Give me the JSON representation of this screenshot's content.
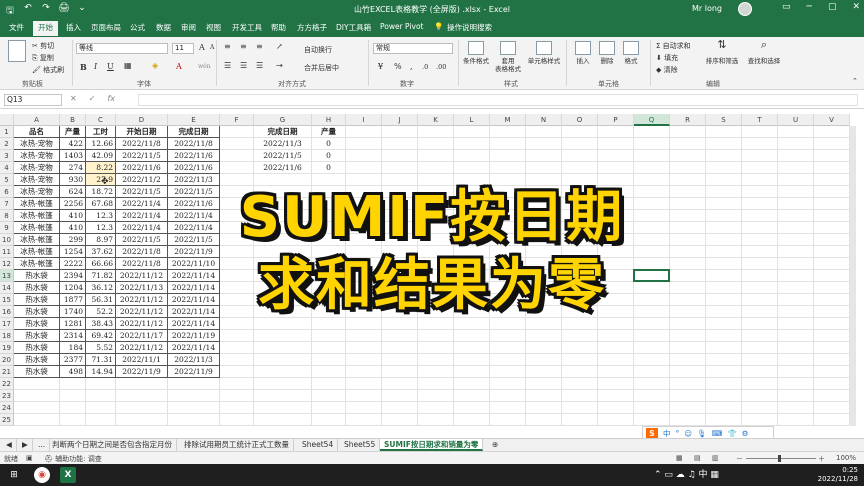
{
  "titlebar": {
    "quick_access": [
      "🖫",
      "↶",
      "↷",
      "🖨",
      "⌄"
    ],
    "title": "山竹EXCEL表格教学 (全屏版) .xlsx  -  Excel",
    "user": "Mr long",
    "window_buttons": [
      "▭",
      "─",
      "▢",
      "✕"
    ]
  },
  "tabs": [
    "文件",
    "开始",
    "插入",
    "页面布局",
    "公式",
    "数据",
    "审阅",
    "视图",
    "开发工具",
    "帮助",
    "方方格子",
    "DIY工具箱",
    "Power Pivot",
    "操作说明搜索"
  ],
  "ribbon": {
    "clipboard": {
      "cut": "✂ 剪切",
      "copy": "⎘ 复制",
      "format_painter": "🖌 格式刷",
      "label": "剪贴板"
    },
    "font": {
      "name": "等线",
      "size": "11",
      "grow": "A",
      "shrink": "A",
      "bold": "B",
      "italic": "I",
      "underline": "U",
      "label": "字体",
      "abc": "wén"
    },
    "alignment": {
      "wrap": "自动换行",
      "merge": "合并后居中",
      "label": "对齐方式"
    },
    "number": {
      "format": "常规",
      "percent": "%",
      "comma": ",",
      "inc": ".0",
      "dec": ".00",
      "label": "数字"
    },
    "styles": {
      "conditional": "条件格式",
      "table": "套用\n表格格式",
      "cell": "单元格样式",
      "label": "样式"
    },
    "cells": {
      "insert": "插入",
      "delete": "删除",
      "format": "格式",
      "label": "单元格"
    },
    "editing": {
      "autosum": "Σ 自动求和",
      "fill": "填充",
      "clear": "清除",
      "sort": "排序和筛选",
      "find": "查找和选择",
      "label": "编辑"
    }
  },
  "formula_bar": {
    "name_box": "Q13",
    "cancel": "✕",
    "enter": "✓",
    "fx": "fx",
    "content": ""
  },
  "columns": [
    "A",
    "B",
    "C",
    "D",
    "E",
    "F",
    "G",
    "H",
    "I",
    "J",
    "K",
    "L",
    "M",
    "N",
    "O",
    "P",
    "Q",
    "R",
    "S",
    "T",
    "U",
    "V"
  ],
  "rows": [
    "1",
    "2",
    "3",
    "4",
    "5",
    "6",
    "7",
    "8",
    "9",
    "10",
    "11",
    "12",
    "13",
    "14",
    "15",
    "16",
    "17",
    "18",
    "19",
    "20",
    "21",
    "22",
    "23",
    "24",
    "25"
  ],
  "table": {
    "headers": [
      "品名",
      "产量",
      "工时",
      "开始日期",
      "完成日期"
    ],
    "rows": [
      [
        "冰热-宠物",
        "422",
        "12.66",
        "2022/11/8",
        "2022/11/8"
      ],
      [
        "冰热-宠物",
        "1403",
        "42.09",
        "2022/11/5",
        "2022/11/6"
      ],
      [
        "冰热-宠物",
        "274",
        "8.22",
        "2022/11/6",
        "2022/11/6"
      ],
      [
        "冰热-宠物",
        "930",
        "27.9",
        "2022/11/2",
        "2022/11/3"
      ],
      [
        "冰热-宠物",
        "624",
        "18.72",
        "2022/11/5",
        "2022/11/5"
      ],
      [
        "冰热-帐篷",
        "2256",
        "67.68",
        "2022/11/4",
        "2022/11/6"
      ],
      [
        "冰热-帐篷",
        "410",
        "12.3",
        "2022/11/4",
        "2022/11/4"
      ],
      [
        "冰热-帐篷",
        "410",
        "12.3",
        "2022/11/4",
        "2022/11/4"
      ],
      [
        "冰热-帐篷",
        "299",
        "8.97",
        "2022/11/5",
        "2022/11/5"
      ],
      [
        "冰热-帐篷",
        "1254",
        "37.62",
        "2022/11/8",
        "2022/11/9"
      ],
      [
        "冰热-帐篷",
        "2222",
        "66.66",
        "2022/11/8",
        "2022/11/10"
      ],
      [
        "热水袋",
        "2394",
        "71.82",
        "2022/11/12",
        "2022/11/14"
      ],
      [
        "热水袋",
        "1204",
        "36.12",
        "2022/11/13",
        "2022/11/14"
      ],
      [
        "热水袋",
        "1877",
        "56.31",
        "2022/11/12",
        "2022/11/14"
      ],
      [
        "热水袋",
        "1740",
        "52.2",
        "2022/11/12",
        "2022/11/14"
      ],
      [
        "热水袋",
        "1281",
        "38.43",
        "2022/11/12",
        "2022/11/14"
      ],
      [
        "热水袋",
        "2314",
        "69.42",
        "2022/11/17",
        "2022/11/19"
      ],
      [
        "热水袋",
        "184",
        "5.52",
        "2022/11/12",
        "2022/11/14"
      ],
      [
        "热水袋",
        "2377",
        "71.31",
        "2022/11/1",
        "2022/11/3"
      ],
      [
        "热水袋",
        "498",
        "14.94",
        "2022/11/9",
        "2022/11/9"
      ]
    ]
  },
  "summary": {
    "headers": [
      "完成日期",
      "产量"
    ],
    "rows": [
      [
        "2022/11/3",
        "0"
      ],
      [
        "2022/11/5",
        "0"
      ],
      [
        "2022/11/6",
        "0"
      ],
      [
        "",
        ""
      ],
      [
        "",
        ""
      ],
      [
        "",
        ""
      ],
      [
        "",
        ""
      ]
    ]
  },
  "headline": {
    "line1": "SUMIF按日期",
    "line2": "求和结果为零"
  },
  "sheet_tabs": [
    "◀",
    "▶",
    "...",
    "判断两个日期之间是否包含指定月份",
    "排除试用期员工统计正式工数量",
    "Sheet54",
    "Sheet55",
    "SUMIF按日期求和销量为零"
  ],
  "ime": {
    "logo": "S",
    "items": [
      "中",
      "°",
      "☺",
      "🎙",
      "⌨",
      "👕",
      "⚙"
    ]
  },
  "status": {
    "ready": "就绪",
    "icon": "▣",
    "accessibility": "⛑ 辅助功能: 调查",
    "zoom_minus": "－",
    "zoom_plus": "＋",
    "zoom": "100%"
  },
  "clock": {
    "time": "0:25",
    "date": "2022/11/28"
  },
  "colors": {
    "excel_green": "#217346",
    "headline_yellow": "#ffd400",
    "highlight": "#fff2cc"
  }
}
